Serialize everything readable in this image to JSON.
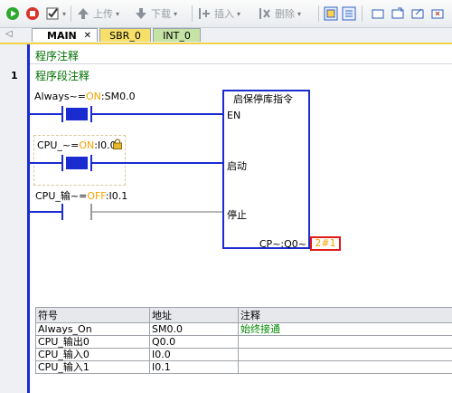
{
  "toolbar": {
    "items": [
      {
        "icon": "run-icon"
      },
      {
        "icon": "stop-icon"
      },
      {
        "icon": "compile-icon"
      },
      {
        "icon": "upload-icon",
        "label": "上传"
      },
      {
        "icon": "download-icon",
        "label": "下载"
      },
      {
        "icon": "insert-icon",
        "label": "插入"
      },
      {
        "icon": "delete-icon",
        "label": "删除"
      }
    ]
  },
  "tabs": [
    {
      "label": "MAIN",
      "active": true
    },
    {
      "label": "SBR_0"
    },
    {
      "label": "INT_0"
    }
  ],
  "editor": {
    "program_comment": "程序注释",
    "network_number": "1",
    "network_comment": "程序段注释",
    "contacts": [
      {
        "operand_prefix": "Always~=",
        "state": "ON",
        "address_suffix": ":SM0.0"
      },
      {
        "operand_prefix": "CPU_~=",
        "state": "ON",
        "address_suffix": ":I0.0"
      },
      {
        "operand_prefix": "CPU_输~=",
        "state": "OFF",
        "address_suffix": ":I0.1"
      }
    ],
    "function_block": {
      "title": "启保停库指令",
      "pins": [
        "EN",
        "启动",
        "停止"
      ],
      "output_pin": "CP~:Q0~",
      "output_value": "2#1"
    },
    "symbol_table": {
      "headers": [
        "符号",
        "地址",
        "注释"
      ],
      "rows": [
        [
          "Always_On",
          "SM0.0",
          "始终接通"
        ],
        [
          "CPU_输出0",
          "Q0.0",
          ""
        ],
        [
          "CPU_输入0",
          "I0.0",
          ""
        ],
        [
          "CPU_输入1",
          "I0.1",
          ""
        ]
      ]
    }
  },
  "colors": {
    "wire": "#1a2bd0",
    "state_text": "#f6a100",
    "comment": "#006e00",
    "highlight": "#e01818"
  }
}
